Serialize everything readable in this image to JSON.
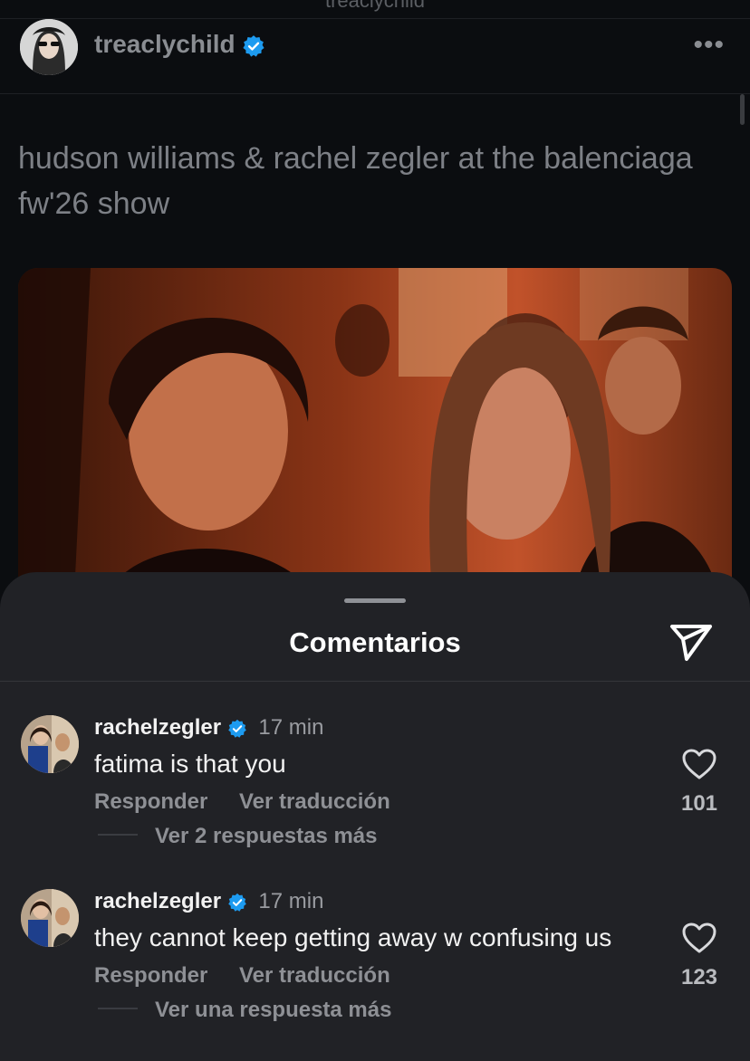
{
  "header": {
    "top_label": "treaclychild",
    "username": "treaclychild",
    "more_icon": "ellipsis-icon",
    "verified_color": "#1d9bf0"
  },
  "post": {
    "caption": "hudson williams & rachel zegler at the balenciaga fw'26 show",
    "image_desc_icon": "photo"
  },
  "comments_sheet": {
    "title": "Comentarios",
    "send_icon": "send-icon",
    "comments": [
      {
        "username": "rachelzegler",
        "time": "17 min",
        "text": "fatima is that you",
        "reply_label": "Responder",
        "translate_label": "Ver traducción",
        "more_replies": "Ver 2 respuestas más",
        "likes": "101"
      },
      {
        "username": "rachelzegler",
        "time": "17 min",
        "text": "they cannot keep getting away w confusing us",
        "reply_label": "Responder",
        "translate_label": "Ver traducción",
        "more_replies": "Ver una respuesta más",
        "likes": "123"
      }
    ]
  }
}
